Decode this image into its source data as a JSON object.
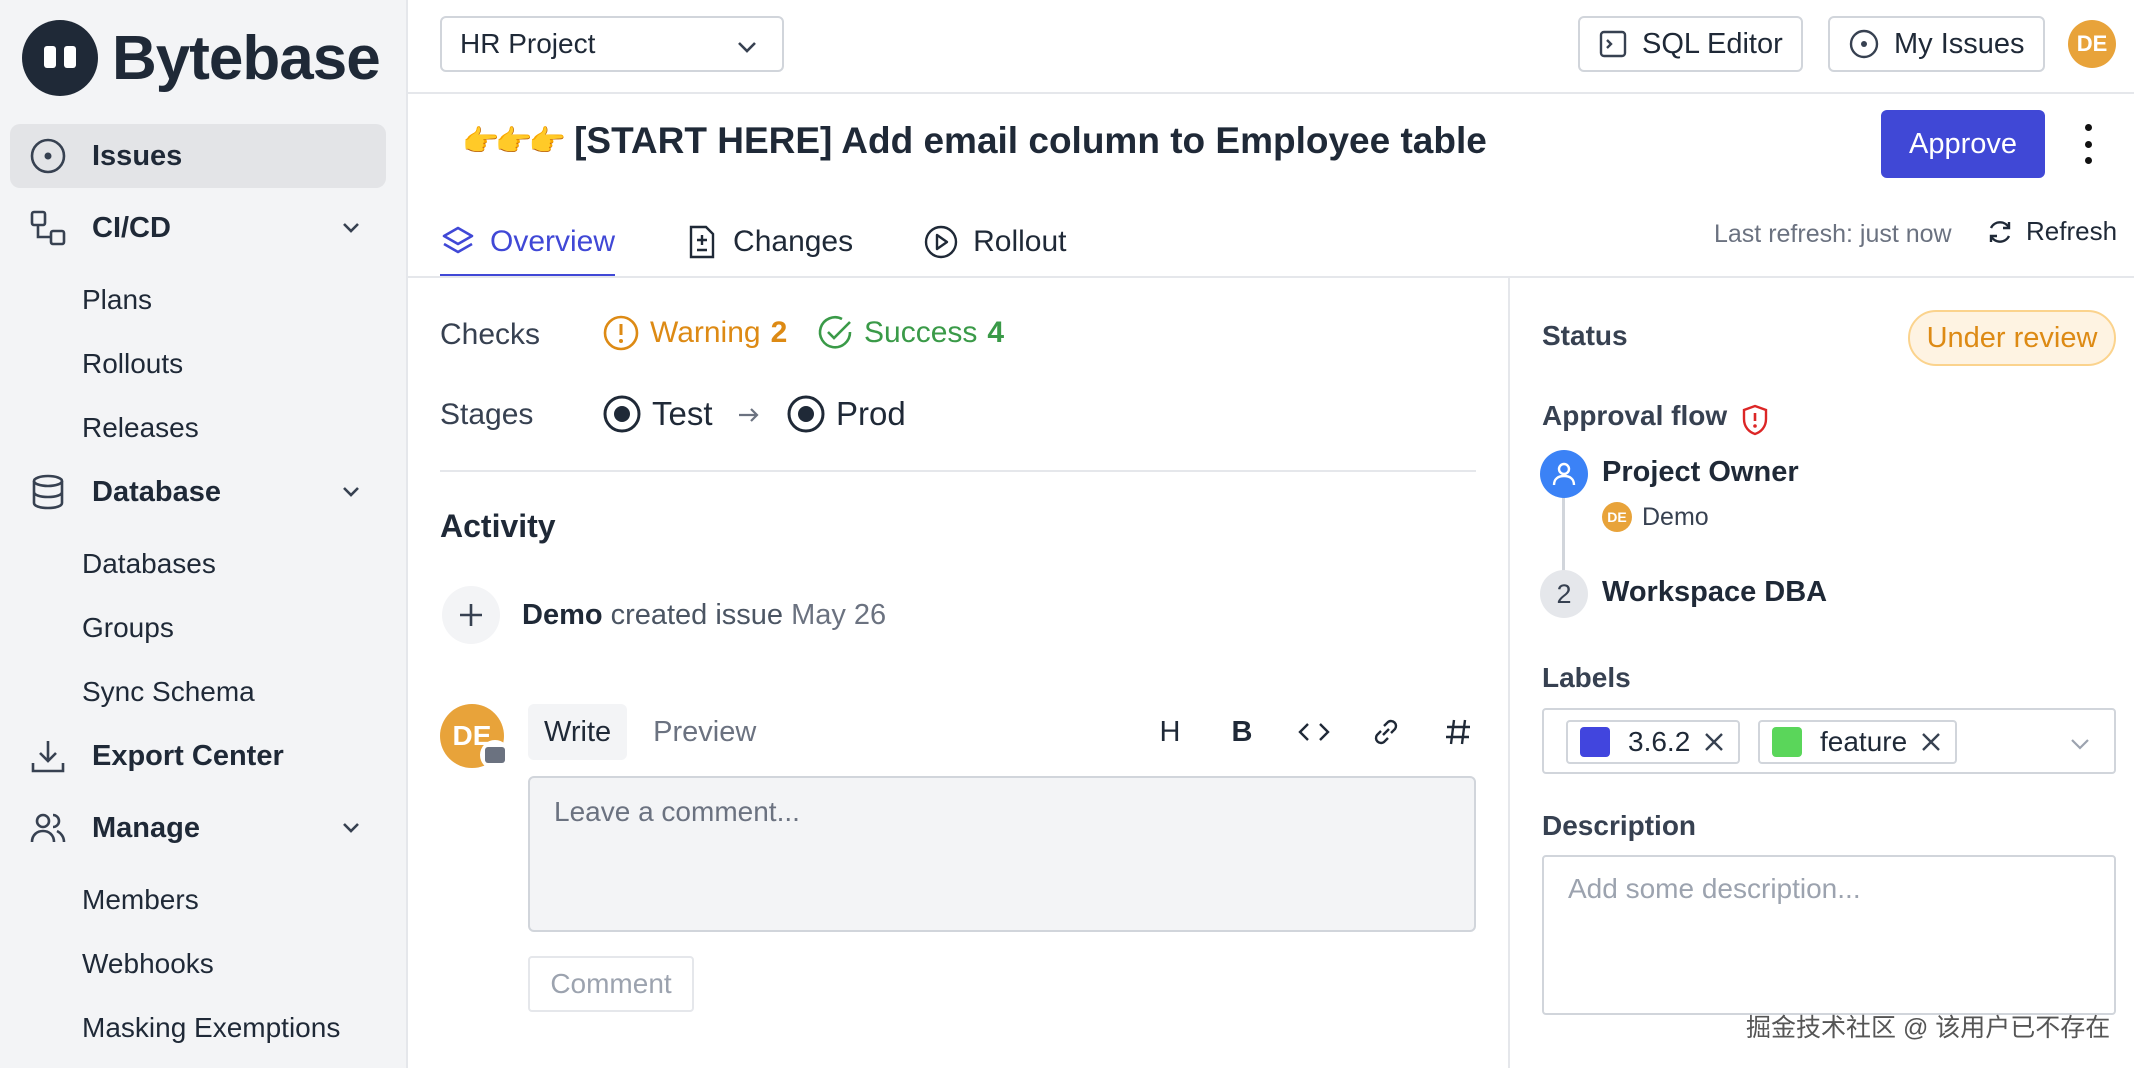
{
  "brand": {
    "name": "Bytebase"
  },
  "sidebar": {
    "items": [
      {
        "label": "Issues",
        "icon": "circle-dot-icon",
        "active": true
      },
      {
        "label": "CI/CD",
        "icon": "workflow-icon",
        "children": [
          "Plans",
          "Rollouts",
          "Releases"
        ]
      },
      {
        "label": "Database",
        "icon": "database-icon",
        "children": [
          "Databases",
          "Groups",
          "Sync Schema"
        ]
      },
      {
        "label": "Export Center",
        "icon": "download-icon"
      },
      {
        "label": "Manage",
        "icon": "users-icon",
        "children": [
          "Members",
          "Webhooks",
          "Masking Exemptions"
        ]
      }
    ]
  },
  "header": {
    "project": "HR Project",
    "sql_editor": "SQL Editor",
    "my_issues": "My Issues",
    "avatar_initials": "DE"
  },
  "issue": {
    "emoji": "👉👉👉",
    "title": "[START HERE] Add email column to Employee table",
    "approve_label": "Approve"
  },
  "tabs": [
    {
      "label": "Overview",
      "active": true
    },
    {
      "label": "Changes"
    },
    {
      "label": "Rollout"
    }
  ],
  "refresh": {
    "last": "Last refresh: just now",
    "button": "Refresh"
  },
  "checks": {
    "label": "Checks",
    "warning": {
      "label": "Warning",
      "count": "2"
    },
    "success": {
      "label": "Success",
      "count": "4"
    }
  },
  "stages": {
    "label": "Stages",
    "items": [
      "Test",
      "Prod"
    ]
  },
  "activity": {
    "title": "Activity",
    "entries": [
      {
        "who": "Demo",
        "what": "created issue",
        "when": "May 26"
      }
    ]
  },
  "comment": {
    "avatar_initials": "DE",
    "tab_write": "Write",
    "tab_preview": "Preview",
    "tools": [
      "H",
      "B"
    ],
    "placeholder": "Leave a comment...",
    "submit": "Comment"
  },
  "right": {
    "status_label": "Status",
    "status_value": "Under review",
    "approval_label": "Approval flow",
    "steps": [
      {
        "name": "Project Owner",
        "user": "Demo",
        "user_initials": "DE"
      },
      {
        "number": "2",
        "name": "Workspace DBA"
      }
    ],
    "labels_label": "Labels",
    "labels": [
      {
        "text": "3.6.2",
        "color": "#4145de"
      },
      {
        "text": "feature",
        "color": "#5ad65a"
      }
    ],
    "description_label": "Description",
    "description_placeholder": "Add some description..."
  },
  "colors": {
    "accent": "#4048d6",
    "warning": "#dd8a14",
    "success": "#3a9a48"
  },
  "watermark": "掘金技术社区 @ 该用户已不存在"
}
